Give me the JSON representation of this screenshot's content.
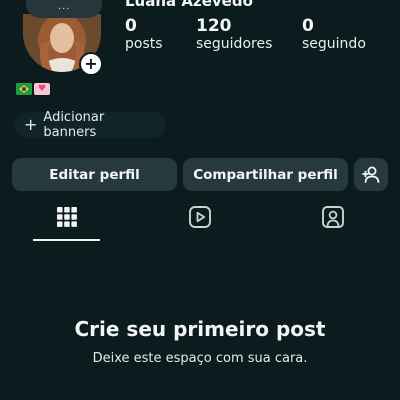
{
  "profile": {
    "name": "Luana Azevedo",
    "note_dots": "...",
    "stats": [
      {
        "value": "0",
        "label": "posts"
      },
      {
        "value": "120",
        "label": "seguidores"
      },
      {
        "value": "0",
        "label": "seguindo"
      }
    ],
    "bio_emojis": [
      "flag-brazil",
      "heart-pink"
    ]
  },
  "banners": {
    "add_label": "Adicionar banners"
  },
  "actions": {
    "edit_label": "Editar perfil",
    "share_label": "Compartilhar perfil",
    "add_person_icon": "add-person-icon"
  },
  "tabs": [
    {
      "icon": "grid-icon",
      "active": true
    },
    {
      "icon": "reels-icon",
      "active": false
    },
    {
      "icon": "tagged-icon",
      "active": false
    }
  ],
  "empty_state": {
    "title": "Crie seu primeiro post",
    "subtitle": "Deixe este espaço com sua cara."
  },
  "colors": {
    "background": "#0c1b1e",
    "button": "#263a3e",
    "text": "#f2f5f6"
  }
}
